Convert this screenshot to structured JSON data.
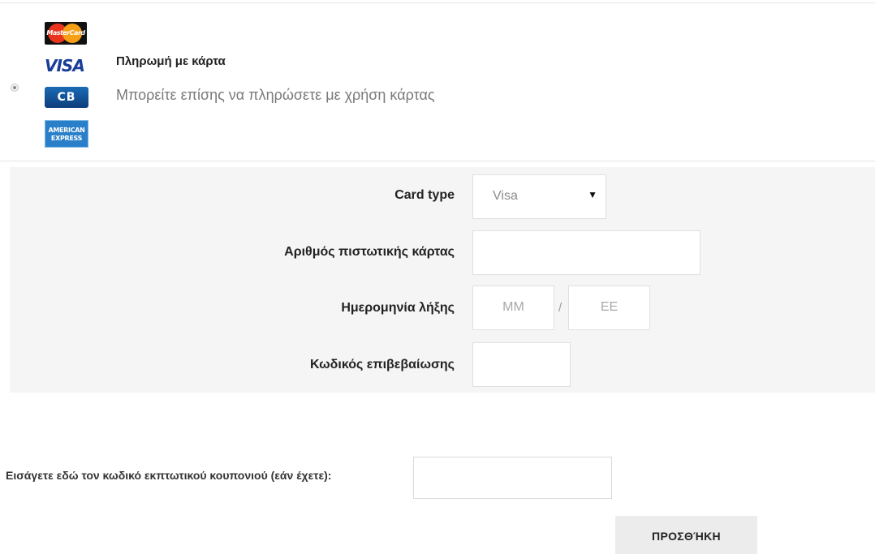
{
  "payment_option": {
    "selected": true,
    "title": "Πληρωμή με κάρτα",
    "description": "Μπορείτε επίσης να πληρώσετε με χρήση κάρτας",
    "card_logos": [
      {
        "name": "mastercard",
        "text": "MasterCard"
      },
      {
        "name": "visa",
        "text": "VISA"
      },
      {
        "name": "cb",
        "text": "CB"
      },
      {
        "name": "american-express",
        "text_line1": "AMERICAN",
        "text_line2": "EXPRESS"
      }
    ]
  },
  "card_form": {
    "card_type": {
      "label": "Card type",
      "value": "Visa",
      "arrow": "▼"
    },
    "card_number": {
      "label": "Αριθμός πιστωτικής κάρτας",
      "value": ""
    },
    "expiry": {
      "label": "Ημερομηνία λήξης",
      "month_placeholder": "MM",
      "separator": "/",
      "year_placeholder": "ΕΕ"
    },
    "cvv": {
      "label": "Κωδικός επιβεβαίωσης",
      "value": ""
    }
  },
  "coupon": {
    "label": "Εισάγετε εδώ τον κωδικό εκπτωτικού κουπονιού (εάν έχετε):",
    "value": "",
    "button_label": "ΠΡΟΣΘΉΚΗ"
  },
  "colors": {
    "panel_background": "#f5f5f5",
    "button_background": "#ececec",
    "visa_blue": "#1a3d9a",
    "muted_text": "#7a7a7a"
  }
}
